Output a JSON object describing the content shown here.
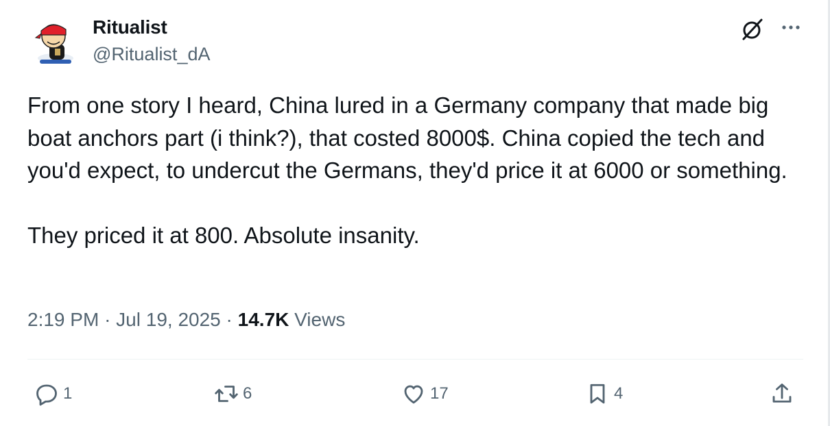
{
  "author": {
    "display_name": "Ritualist",
    "handle": "@Ritualist_dA"
  },
  "tweet": {
    "paragraphs": [
      "From one story I heard, China lured in a Germany company that made big boat anchors part (i think?), that costed 8000$. China copied the tech and you'd expect, to undercut the Germans, they'd price it at 6000 or something.",
      "They priced it at 800. Absolute insanity."
    ]
  },
  "meta": {
    "time": "2:19 PM",
    "separator": "·",
    "date": "Jul 19, 2025",
    "views_count": "14.7K",
    "views_label": "Views"
  },
  "actions": {
    "replies": "1",
    "reposts": "6",
    "likes": "17",
    "bookmarks": "4"
  },
  "colors": {
    "text": "#0f1419",
    "secondary": "#536471",
    "divider": "#eff3f4",
    "avatar_bandana": "#e0202a"
  },
  "icons": [
    "grok-icon",
    "more-icon",
    "reply-icon",
    "repost-icon",
    "like-icon",
    "bookmark-icon",
    "share-icon"
  ]
}
